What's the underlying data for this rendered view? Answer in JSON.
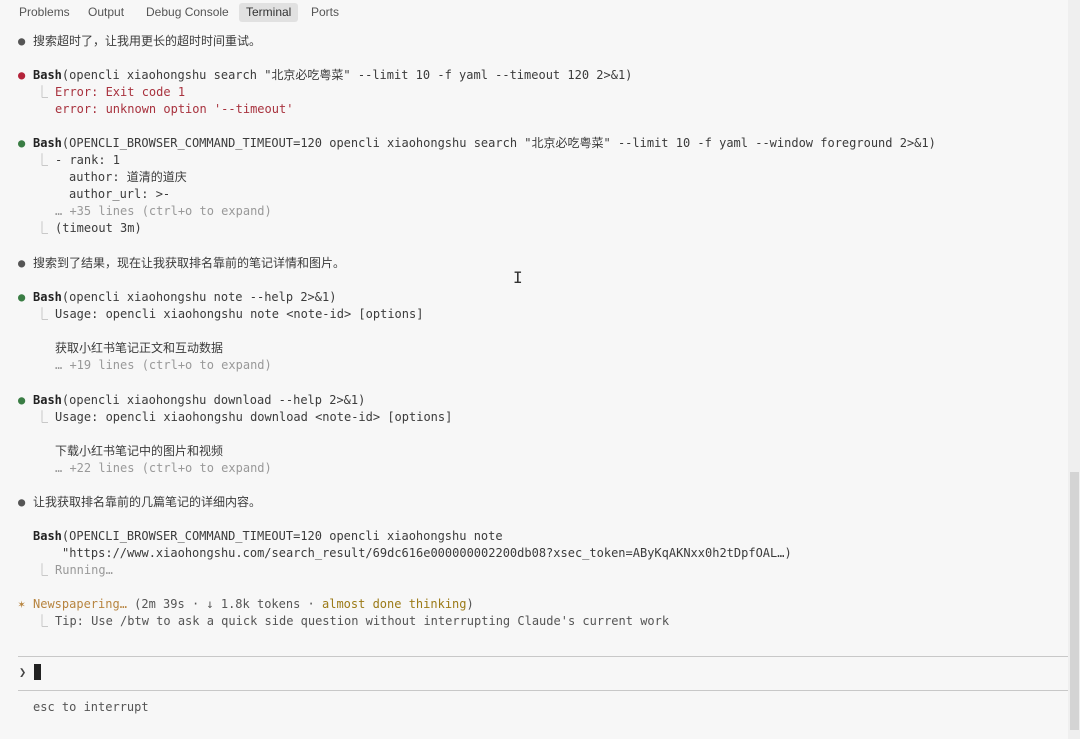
{
  "panel": {
    "tabs": [
      {
        "label": "Problems",
        "active": false
      },
      {
        "label": "Output",
        "active": false
      },
      {
        "label": "Debug Console",
        "active": false
      },
      {
        "label": "Terminal",
        "active": true
      },
      {
        "label": "Ports",
        "active": false
      }
    ]
  },
  "terminal": {
    "msg1": "搜索超时了，让我用更长的超时时间重试。",
    "cmd1": {
      "tool": "Bash",
      "args": "(opencli xiaohongshu search \"北京必吃粤菜\" --limit 10 -f yaml --timeout 120 2>&1)",
      "out1": "Error: Exit code 1",
      "out2": "error: unknown option '--timeout'"
    },
    "cmd2": {
      "tool": "Bash",
      "args": "(OPENCLI_BROWSER_COMMAND_TIMEOUT=120 opencli xiaohongshu search \"北京必吃粤菜\" --limit 10 -f yaml --window foreground 2>&1)",
      "out1": "- rank: 1",
      "out2": "author: 道清的道庆",
      "out3": "author_url: >-",
      "more": "… +35 lines (ctrl+o to expand)",
      "out4": "(timeout 3m)"
    },
    "msg2": "搜索到了结果，现在让我获取排名靠前的笔记详情和图片。",
    "cmd3": {
      "tool": "Bash",
      "args": "(opencli xiaohongshu note --help 2>&1)",
      "out1": "Usage: opencli xiaohongshu note <note-id> [options]",
      "out2": "获取小红书笔记正文和互动数据",
      "more": "… +19 lines (ctrl+o to expand)"
    },
    "cmd4": {
      "tool": "Bash",
      "args": "(opencli xiaohongshu download --help 2>&1)",
      "out1": "Usage: opencli xiaohongshu download <note-id> [options]",
      "out2": "下载小红书笔记中的图片和视频",
      "more": "… +22 lines (ctrl+o to expand)"
    },
    "msg3": "让我获取排名靠前的几篇笔记的详细内容。",
    "cmd5": {
      "tool": "Bash",
      "args": "(OPENCLI_BROWSER_COMMAND_TIMEOUT=120 opencli xiaohongshu note",
      "args2": "\"https://www.xiaohongshu.com/search_result/69dc616e000000002200db08?xsec_token=AByKqAKNxx0h2tDpfOAL…)",
      "status": "Running…"
    },
    "spinner": {
      "word": "Newspapering…",
      "stats": "(2m 39s · ↓ 1.8k tokens · ",
      "thinking": "almost done thinking",
      "close": ")"
    },
    "tip": "Tip: Use /btw to ask a quick side question without interrupting Claude's current work",
    "prompt_symbol": "❯",
    "footer": "esc to interrupt",
    "branch": "⎿",
    "bullet": "●",
    "star": "✶"
  }
}
